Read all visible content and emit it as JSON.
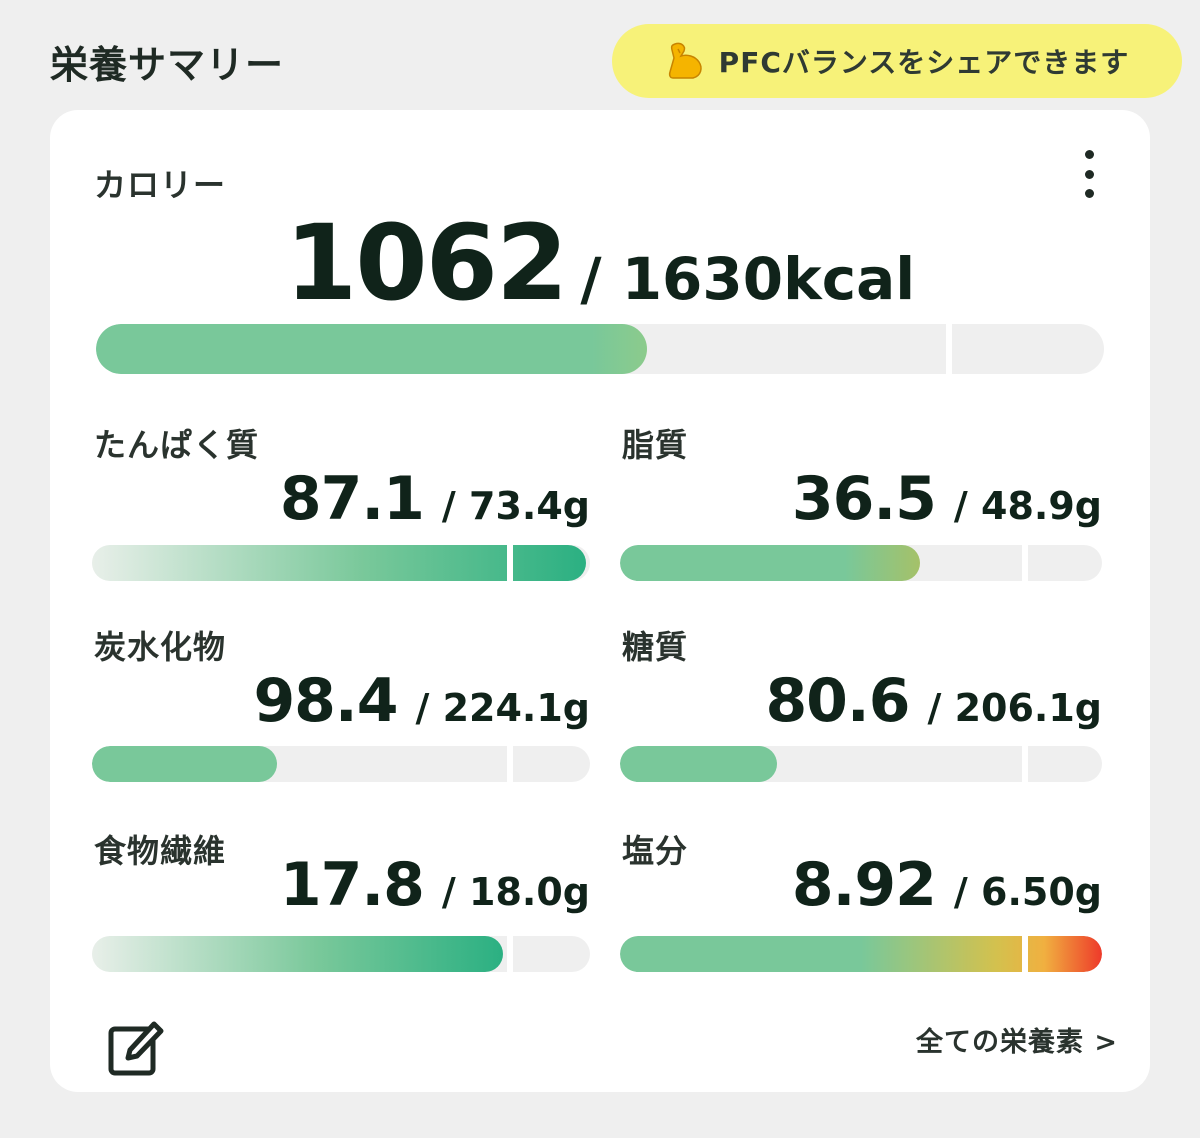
{
  "header": {
    "title": "栄養サマリー",
    "share_banner_text": "PFCバランスをシェアできます",
    "share_banner_icon": "flexed-biceps-icon"
  },
  "calorie": {
    "label": "カロリー",
    "value": "1062",
    "target": "/ 1630kcal",
    "progress": 0.5466,
    "marker": 0.8431
  },
  "nutrients": [
    {
      "name": "たんぱく質",
      "value": "87.1",
      "target": "/ 73.4g",
      "progress": 0.9917,
      "marker": 0.8336,
      "style": "gradient-dark"
    },
    {
      "name": "脂質",
      "value": "36.5",
      "target": "/ 48.9g",
      "progress": 0.6218,
      "marker": 0.8336,
      "style": "green-olive"
    },
    {
      "name": "炭水化物",
      "value": "98.4",
      "target": "/ 224.1g",
      "progress": 0.3707,
      "marker": 0.8336,
      "style": "green"
    },
    {
      "name": "糖質",
      "value": "80.6",
      "target": "/ 206.1g",
      "progress": 0.3264,
      "marker": 0.8336,
      "style": "green"
    },
    {
      "name": "食物繊維",
      "value": "17.8",
      "target": "/ 18.0g",
      "progress": 0.8255,
      "marker": 0.8336,
      "style": "gradient-dark"
    },
    {
      "name": "塩分",
      "value": "8.92",
      "target": "/ 6.50g",
      "progress": 1.0,
      "marker": 0.8336,
      "style": "warning"
    }
  ],
  "footer": {
    "all_nutrients_link": "全ての栄養素 >",
    "edit_icon": "edit-icon"
  },
  "colors": {
    "green": "#79c89a",
    "green_dark": "#2bb082",
    "banner_yellow": "#f7f279",
    "warn_orange": "#f0b040",
    "warn_red": "#ee3a2a"
  }
}
